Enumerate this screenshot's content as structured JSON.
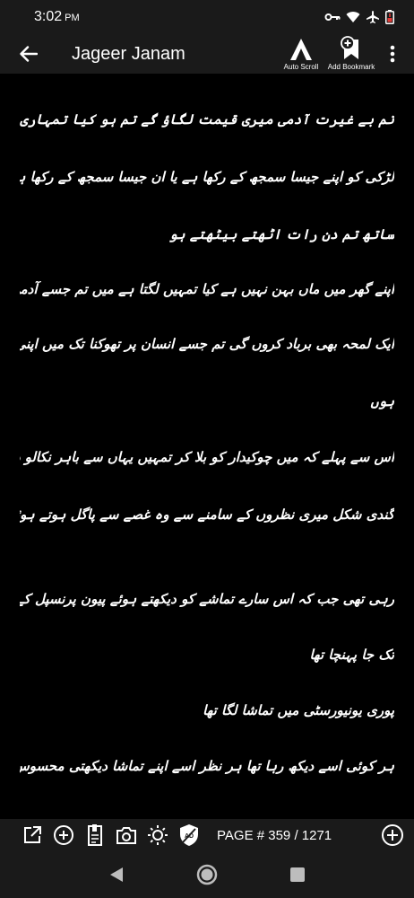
{
  "status": {
    "time": "3:02",
    "ampm": "PM"
  },
  "header": {
    "title": "Jageer Janam",
    "auto_scroll_label": "Auto Scroll",
    "add_bookmark_label": "Add Bookmark"
  },
  "content": {
    "lines": [
      "تم بے غیرت آدمی میری قیمت لگاؤ گے تم ہو کیا تمہاری اوقات کیا ہے۔ ہر",
      "لڑکی کو اپنے جیسا سمجھ کے رکھا ہے یا ان جیسا سمجھ کے رکھا ہے جس کے",
      "ساتھ تم دن رات اٹھتے بیٹھتے ہو",
      "اپنے گھر میں ماں بہن نہیں ہے کیا تمہیں لگتا ہے میں تم جسے آدمی کے ساتھ",
      "ایک لمحہ بھی برباد کروں گی تم جسے انسان پر تھوکنا تک میں اپنی توہین سمجھتی",
      "ہوں",
      "اس سے پہلے کہ میں چوکیدار کو بلا کر تمہیں یہاں سے باہر نکالو دفع کرو اپنی",
      "گندی شکل میری نظروں کے سامنے سے وہ غصے سے پاگل ہوتے ہوئے بول",
      "رہی تھی جب کہ اس سارے تماشے کو دیکھتے ہوئے پیون پرنسپل کے آفس",
      "تک جا پہنچا تھا",
      "پوری یونیورسٹی میں تماشا لگا تھا",
      "ہر کوئی اسے دیکھ رہا تھا ہر نظر اسے اپنے تماشا دیکھتی محسوس ہو رہی تھی اس کا"
    ]
  },
  "footer": {
    "page_label": "PAGE # 359 / 1271"
  }
}
